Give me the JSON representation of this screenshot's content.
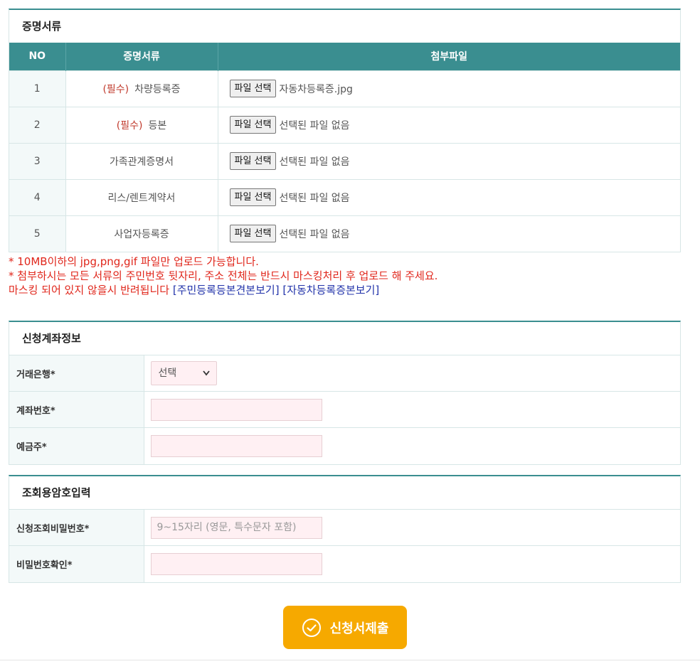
{
  "docs": {
    "title": "증명서류",
    "headers": {
      "no": "NO",
      "name": "증명서류",
      "file": "첨부파일"
    },
    "file_button": "파일 선택",
    "rows": [
      {
        "no": "1",
        "req": "(필수)",
        "name": "차량등록증",
        "file": "자동차등록증.jpg"
      },
      {
        "no": "2",
        "req": "(필수)",
        "name": "등본",
        "file": "선택된 파일 없음"
      },
      {
        "no": "3",
        "req": "",
        "name": "가족관계증명서",
        "file": "선택된 파일 없음"
      },
      {
        "no": "4",
        "req": "",
        "name": "리스/렌트계약서",
        "file": "선택된 파일 없음"
      },
      {
        "no": "5",
        "req": "",
        "name": "사업자등록증",
        "file": "선택된 파일 없음"
      }
    ]
  },
  "notes": {
    "line1": "* 10MB이하의 jpg,png,gif 파일만 업로드 가능합니다.",
    "line2": "* 첨부하시는 모든 서류의 주민번호 뒷자리, 주소 전체는 반드시 마스킹처리 후 업로드 해 주세요.",
    "line3": "마스킹 되어 있지 않을시 반려됩니다",
    "link1": "[주민등록등본견본보기]",
    "link2": "[자동차등록증본보기]"
  },
  "account": {
    "title": "신청계좌정보",
    "bank_label": "거래은행*",
    "bank_value": "선택",
    "number_label": "계좌번호*",
    "holder_label": "예금주*"
  },
  "password": {
    "title": "조회용암호입력",
    "pw_label": "신청조회비밀번호*",
    "pw_placeholder": "9~15자리 (영문, 특수문자 포함)",
    "confirm_label": "비밀번호확인*"
  },
  "submit_label": "신청서제출",
  "colors": {
    "teal": "#3a8e90",
    "accent": "#f6a900",
    "warn": "#e0261b",
    "link": "#2233aa"
  }
}
